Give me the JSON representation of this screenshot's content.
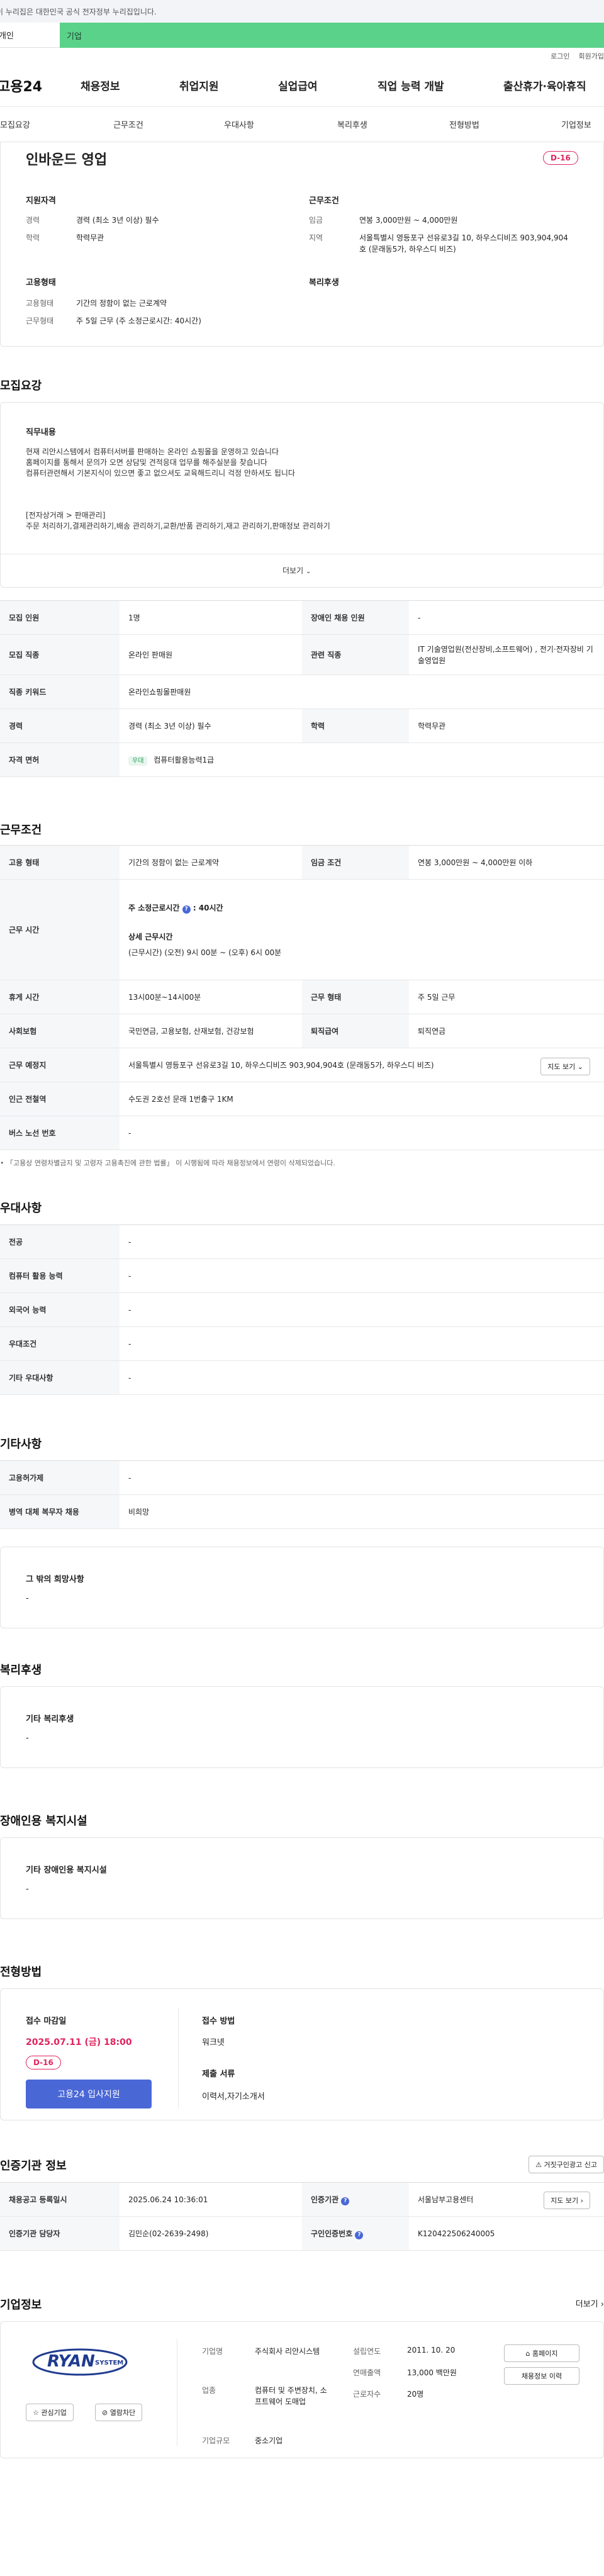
{
  "gov_banner": "이 누리집은 대한민국 공식 전자정부 누리집입니다.",
  "top_tabs": [
    "개인",
    "기업"
  ],
  "util_links": [
    "로그인",
    "회원가입"
  ],
  "gnb": {
    "logo": "고용24",
    "items": [
      "채용정보",
      "취업지원",
      "실업급여",
      "직업 능력 개발",
      "출산휴가·육아휴직"
    ]
  },
  "subnav": [
    "모집요강",
    "근무조건",
    "우대사항",
    "복리후생",
    "전형방법",
    "기업정보"
  ],
  "summary": {
    "title": "인바운드 영업",
    "dday": "D-16",
    "qual_title": "지원자격",
    "qual": [
      {
        "k": "경력",
        "v": "경력 (최소 3년 이상) 필수"
      },
      {
        "k": "학력",
        "v": "학력무관"
      }
    ],
    "emp_title": "고용형태",
    "emp": [
      {
        "k": "고용형태",
        "v": "기간의 정함이 없는 근로계약"
      },
      {
        "k": "근무형태",
        "v": "주 5일 근무 (주 소정근로시간: 40시간)"
      }
    ],
    "cond_title": "근무조건",
    "cond": [
      {
        "k": "임금",
        "v": "연봉 3,000만원 ~ 4,000만원"
      },
      {
        "k": "지역",
        "v": "서울특별시 영등포구 선유로3길 10, 하우스디비즈 903,904,904호 (문래동5가, 하우스디 비즈)"
      }
    ],
    "welfare_title": "복리후생"
  },
  "recruit": {
    "title": "모집요강",
    "job_title": "직무내용",
    "job_lines": [
      "현재 리안시스템에서 컴퓨터서버를 판매하는 온라인 쇼핑몰을 운영하고 있습니다",
      "홈페이지를 통해서 문의가 오면 상담및 견적응대 업무를 해주실분을 찾습니다",
      "컴퓨터관련해서 기본지식이 있으면 좋고 없으셔도 교육해드리니 걱정 안하셔도 됩니다",
      "",
      "[전자상거래 > 판매관리]",
      "주문 처리하기,결제관리하기,배송 관리하기,교환/반품 관리하기,재고 관리하기,판매정보 관리하기"
    ],
    "more": "더보기",
    "rows": [
      {
        "h1": "모집 인원",
        "v1": "1명",
        "h2": "장애인 채용 인원",
        "v2": "-"
      },
      {
        "h1": "모집 직종",
        "v1": "온라인 판매원",
        "h2": "관련 직종",
        "v2": "IT 기술영업원(전산장비,소프트웨어) , 전기·전자장비 기술영업원"
      },
      {
        "h1": "직종 키워드",
        "v1": "온라인쇼핑몰판매원"
      },
      {
        "h1": "경력",
        "v1": "경력 (최소 3년 이상) 필수",
        "h2": "학력",
        "v2": "학력무관"
      },
      {
        "h1": "자격 면허",
        "badge": "우대",
        "v1": "컴퓨터활용능력1급"
      }
    ]
  },
  "work": {
    "title": "근무조건",
    "emp_h": "고용 형태",
    "emp_v": "기간의 정함이 없는 근로계약",
    "wage_h": "임금 조건",
    "wage_v": "연봉 3,000만원 ~ 4,000만원 이하",
    "time_h": "근무 시간",
    "time_main": "주 소정근로시간",
    "time_main_val": ": 40시간",
    "time_detail_h": "상세 근무시간",
    "time_detail": "(근무시간) (오전) 9시 00분 ~ (오후) 6시 00분",
    "rest_h": "휴게 시간",
    "rest_v": "13시00분~14시00분",
    "shape_h": "근무 형태",
    "shape_v": "주 5일 근무",
    "ins_h": "사회보험",
    "ins_v": "국민연금, 고용보험, 산재보험, 건강보험",
    "ret_h": "퇴직급여",
    "ret_v": "퇴직연금",
    "place_h": "근무 예정지",
    "place_v": "서울특별시 영등포구 선유로3길 10, 하우스디비즈 903,904,904호 (문래동5가, 하우스디 비즈)",
    "map_btn": "지도 보기",
    "subway_h": "인근 전철역",
    "subway_v": "수도권 2호선 문래 1번출구 1KM",
    "bus_h": "버스 노선 번호",
    "bus_v": "-",
    "note": "「고용상 연령차별금지 및 고령자 고용촉진에 관한 법률」 이 시행됨에 따라 채용정보에서 연령이 삭제되었습니다."
  },
  "pref": {
    "title": "우대사항",
    "rows": [
      {
        "h": "전공",
        "v": "-"
      },
      {
        "h": "컴퓨터 활용 능력",
        "v": "-"
      },
      {
        "h": "외국어 능력",
        "v": "-"
      },
      {
        "h": "우대조건",
        "v": "-"
      },
      {
        "h": "기타 우대사항",
        "v": "-"
      }
    ]
  },
  "etc": {
    "title": "기타사항",
    "rows": [
      {
        "h": "고용허가제",
        "v": "-"
      },
      {
        "h": "병역 대체 복무자 채용",
        "v": "비희망"
      }
    ],
    "hope_title": "그 밖의 희망사항",
    "hope_v": "-"
  },
  "welfare": {
    "title": "복리후생",
    "box_title": "기타 복리후생",
    "box_v": "-"
  },
  "disabled": {
    "title": "장애인용 복지시설",
    "box_title": "기타 장애인용 복지시설",
    "box_v": "-"
  },
  "process": {
    "title": "전형방법",
    "deadline_label": "접수 마감일",
    "deadline": "2025.07.11 (금) 18:00",
    "dday": "D-16",
    "apply_btn": "고용24 입사지원",
    "method_label": "접수 방법",
    "method_v": "워크넷",
    "docs_label": "제출 서류",
    "docs_v": "이력서,자기소개서"
  },
  "agency": {
    "title": "인증기관 정보",
    "report_btn": "거짓구인광고 신고",
    "reg_h": "채용공고 등록일시",
    "reg_v": "2025.06.24 10:36:01",
    "org_h": "인증기관",
    "org_v": "서울남부고용센터",
    "map_btn": "지도 보기",
    "staff_h": "인증기관 담당자",
    "staff_v": "김민순(02-2639-2498)",
    "num_h": "구인인증번호",
    "num_v": "K120422506240005"
  },
  "company": {
    "title": "기업정보",
    "more": "더보기",
    "logo_text": "RYAN",
    "logo_sub": "SYSTEM",
    "fav_btn": "관심기업",
    "block_btn": "열람차단",
    "name_k": "기업명",
    "name_v": "주식회사 리안시스템",
    "ind_k": "업종",
    "ind_v": "컴퓨터 및 주변장치, 소프트웨어 도매업",
    "size_k": "기업규모",
    "size_v": "중소기업",
    "est_k": "설립연도",
    "est_v": "2011. 10. 20",
    "sales_k": "연매출액",
    "sales_v": "13,000 백만원",
    "emp_k": "근로자수",
    "emp_v": "20명",
    "home_btn": "홈페이지",
    "jobs_btn": "채용정보 이력"
  },
  "colors": {
    "accent_green": "#5bd28a",
    "dday_red": "#e0245e",
    "primary_blue": "#4a67d6"
  }
}
